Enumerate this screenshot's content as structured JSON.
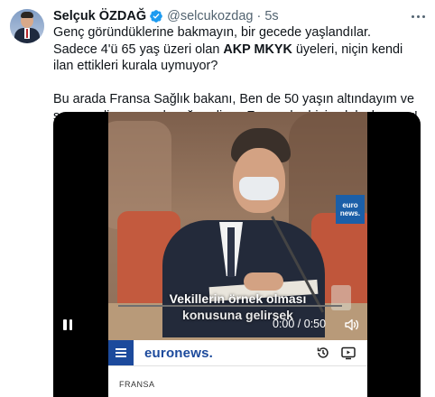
{
  "tweet": {
    "author_name": "Selçuk ÖZDAĞ",
    "handle": "@selcukozdag",
    "separator": "·",
    "time": "5s",
    "text_line1": "Genç göründüklerine bakmayın, bir gecede yaşlandılar.",
    "text_line2_pre": "Sadece 4'ü 65 yaş üzeri olan ",
    "text_line2_bold": "AKP MKYK",
    "text_line2_post": " üyeleri, niçin kendi ilan ettikleri kurala uymuyor?",
    "para2_pre": "Bu arada Fransa Sağlık bakanı, Ben de 50 yaşın altındayım ve sıram gelince ",
    "para2_bold": "aşı",
    "para2_post": " olacağım diyor. Fransızlar bizi çok kıskanıyor!"
  },
  "video": {
    "subtitle_line1": "Vekillerin örnek olması",
    "subtitle_line2": "konusuna gelirsek",
    "watermark_line1": "euro",
    "watermark_line2": "news.",
    "time_display": "0:00 / 0:50",
    "progress": 0,
    "accent_color": "#1d9bf0"
  },
  "embedded_site": {
    "brand": "euronews.",
    "section": "FRANSA",
    "brand_color": "#1c4a9c"
  },
  "icons": {
    "verified": "verified-badge-icon",
    "more": "more-icon",
    "pause": "pause-icon",
    "volume": "volume-icon",
    "menu": "hamburger-menu-icon",
    "history": "history-icon",
    "tv": "tv-icon"
  }
}
